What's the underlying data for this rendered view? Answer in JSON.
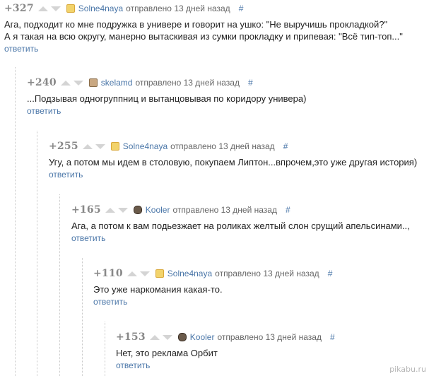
{
  "comments": [
    {
      "score": "+327",
      "author": "Solne4naya",
      "avatar": "solne-avatar",
      "sent": "отправлено 13 дней назад",
      "hash": "#",
      "lines": [
        "Ага, подходит ко мне подружка в универе и говорит на ушко: \"Не выручишь прокладкой?\"",
        "А я такая на всю округу, манерно вытаскивая из сумки прокладку и припевая: \"Всё тип-топ...\""
      ],
      "reply": "ответить"
    },
    {
      "score": "+240",
      "author": "skelamd",
      "avatar": "skelamd-avatar",
      "sent": "отправлено 13 дней назад",
      "hash": "#",
      "lines": [
        "...Подзывая одногруппниц и вытанцовывая по коридору универа)"
      ],
      "reply": "ответить"
    },
    {
      "score": "+255",
      "author": "Solne4naya",
      "avatar": "solne-avatar",
      "sent": "отправлено 13 дней назад",
      "hash": "#",
      "lines": [
        "Угу, а потом мы идем в столовую, покупаем Липтон...впрочем,это уже другая история)"
      ],
      "reply": "ответить"
    },
    {
      "score": "+165",
      "author": "Kooler",
      "avatar": "kooler-avatar",
      "sent": "отправлено 13 дней назад",
      "hash": "#",
      "lines": [
        "Ага, а потом к вам подьезжает на роликах желтый слон срущий апельсинами..,"
      ],
      "reply": "ответить"
    },
    {
      "score": "+110",
      "author": "Solne4naya",
      "avatar": "solne-avatar",
      "sent": "отправлено 13 дней назад",
      "hash": "#",
      "lines": [
        "Это уже наркомания какая-то."
      ],
      "reply": "ответить"
    },
    {
      "score": "+153",
      "author": "Kooler",
      "avatar": "kooler-avatar",
      "sent": "отправлено 13 дней назад",
      "hash": "#",
      "lines": [
        "Нет, это реклама Орбит"
      ],
      "reply": "ответить"
    }
  ],
  "watermark": "pikabu.ru"
}
